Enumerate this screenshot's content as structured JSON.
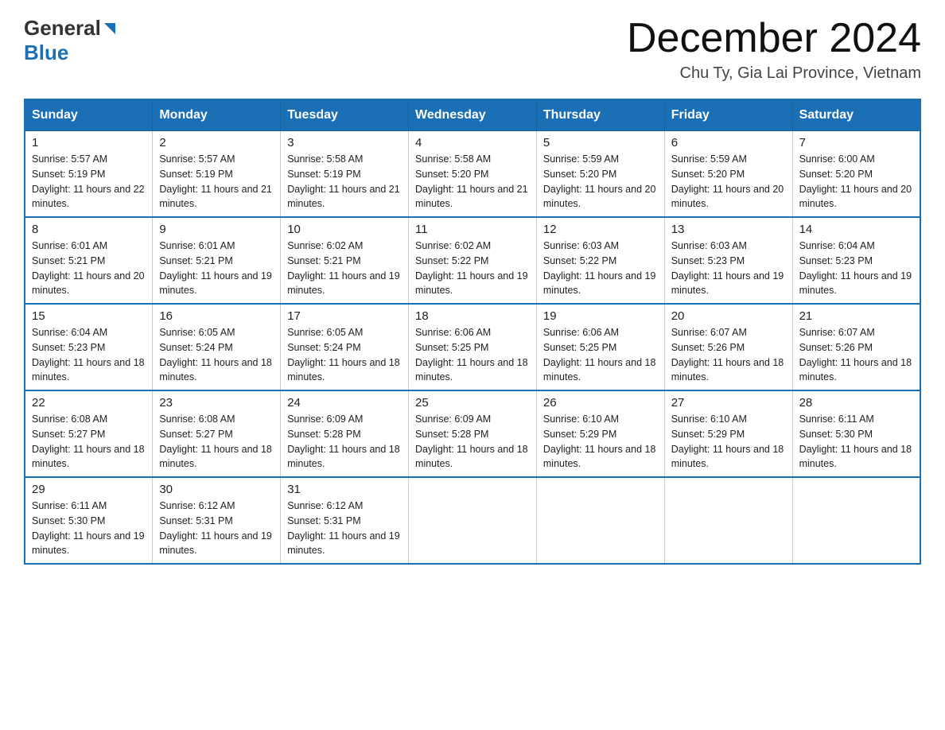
{
  "header": {
    "logo_general": "General",
    "logo_blue": "Blue",
    "month_title": "December 2024",
    "location": "Chu Ty, Gia Lai Province, Vietnam"
  },
  "calendar": {
    "days_of_week": [
      "Sunday",
      "Monday",
      "Tuesday",
      "Wednesday",
      "Thursday",
      "Friday",
      "Saturday"
    ],
    "weeks": [
      [
        {
          "day": "1",
          "sunrise": "5:57 AM",
          "sunset": "5:19 PM",
          "daylight": "11 hours and 22 minutes."
        },
        {
          "day": "2",
          "sunrise": "5:57 AM",
          "sunset": "5:19 PM",
          "daylight": "11 hours and 21 minutes."
        },
        {
          "day": "3",
          "sunrise": "5:58 AM",
          "sunset": "5:19 PM",
          "daylight": "11 hours and 21 minutes."
        },
        {
          "day": "4",
          "sunrise": "5:58 AM",
          "sunset": "5:20 PM",
          "daylight": "11 hours and 21 minutes."
        },
        {
          "day": "5",
          "sunrise": "5:59 AM",
          "sunset": "5:20 PM",
          "daylight": "11 hours and 20 minutes."
        },
        {
          "day": "6",
          "sunrise": "5:59 AM",
          "sunset": "5:20 PM",
          "daylight": "11 hours and 20 minutes."
        },
        {
          "day": "7",
          "sunrise": "6:00 AM",
          "sunset": "5:20 PM",
          "daylight": "11 hours and 20 minutes."
        }
      ],
      [
        {
          "day": "8",
          "sunrise": "6:01 AM",
          "sunset": "5:21 PM",
          "daylight": "11 hours and 20 minutes."
        },
        {
          "day": "9",
          "sunrise": "6:01 AM",
          "sunset": "5:21 PM",
          "daylight": "11 hours and 19 minutes."
        },
        {
          "day": "10",
          "sunrise": "6:02 AM",
          "sunset": "5:21 PM",
          "daylight": "11 hours and 19 minutes."
        },
        {
          "day": "11",
          "sunrise": "6:02 AM",
          "sunset": "5:22 PM",
          "daylight": "11 hours and 19 minutes."
        },
        {
          "day": "12",
          "sunrise": "6:03 AM",
          "sunset": "5:22 PM",
          "daylight": "11 hours and 19 minutes."
        },
        {
          "day": "13",
          "sunrise": "6:03 AM",
          "sunset": "5:23 PM",
          "daylight": "11 hours and 19 minutes."
        },
        {
          "day": "14",
          "sunrise": "6:04 AM",
          "sunset": "5:23 PM",
          "daylight": "11 hours and 19 minutes."
        }
      ],
      [
        {
          "day": "15",
          "sunrise": "6:04 AM",
          "sunset": "5:23 PM",
          "daylight": "11 hours and 18 minutes."
        },
        {
          "day": "16",
          "sunrise": "6:05 AM",
          "sunset": "5:24 PM",
          "daylight": "11 hours and 18 minutes."
        },
        {
          "day": "17",
          "sunrise": "6:05 AM",
          "sunset": "5:24 PM",
          "daylight": "11 hours and 18 minutes."
        },
        {
          "day": "18",
          "sunrise": "6:06 AM",
          "sunset": "5:25 PM",
          "daylight": "11 hours and 18 minutes."
        },
        {
          "day": "19",
          "sunrise": "6:06 AM",
          "sunset": "5:25 PM",
          "daylight": "11 hours and 18 minutes."
        },
        {
          "day": "20",
          "sunrise": "6:07 AM",
          "sunset": "5:26 PM",
          "daylight": "11 hours and 18 minutes."
        },
        {
          "day": "21",
          "sunrise": "6:07 AM",
          "sunset": "5:26 PM",
          "daylight": "11 hours and 18 minutes."
        }
      ],
      [
        {
          "day": "22",
          "sunrise": "6:08 AM",
          "sunset": "5:27 PM",
          "daylight": "11 hours and 18 minutes."
        },
        {
          "day": "23",
          "sunrise": "6:08 AM",
          "sunset": "5:27 PM",
          "daylight": "11 hours and 18 minutes."
        },
        {
          "day": "24",
          "sunrise": "6:09 AM",
          "sunset": "5:28 PM",
          "daylight": "11 hours and 18 minutes."
        },
        {
          "day": "25",
          "sunrise": "6:09 AM",
          "sunset": "5:28 PM",
          "daylight": "11 hours and 18 minutes."
        },
        {
          "day": "26",
          "sunrise": "6:10 AM",
          "sunset": "5:29 PM",
          "daylight": "11 hours and 18 minutes."
        },
        {
          "day": "27",
          "sunrise": "6:10 AM",
          "sunset": "5:29 PM",
          "daylight": "11 hours and 18 minutes."
        },
        {
          "day": "28",
          "sunrise": "6:11 AM",
          "sunset": "5:30 PM",
          "daylight": "11 hours and 18 minutes."
        }
      ],
      [
        {
          "day": "29",
          "sunrise": "6:11 AM",
          "sunset": "5:30 PM",
          "daylight": "11 hours and 19 minutes."
        },
        {
          "day": "30",
          "sunrise": "6:12 AM",
          "sunset": "5:31 PM",
          "daylight": "11 hours and 19 minutes."
        },
        {
          "day": "31",
          "sunrise": "6:12 AM",
          "sunset": "5:31 PM",
          "daylight": "11 hours and 19 minutes."
        },
        null,
        null,
        null,
        null
      ]
    ]
  }
}
